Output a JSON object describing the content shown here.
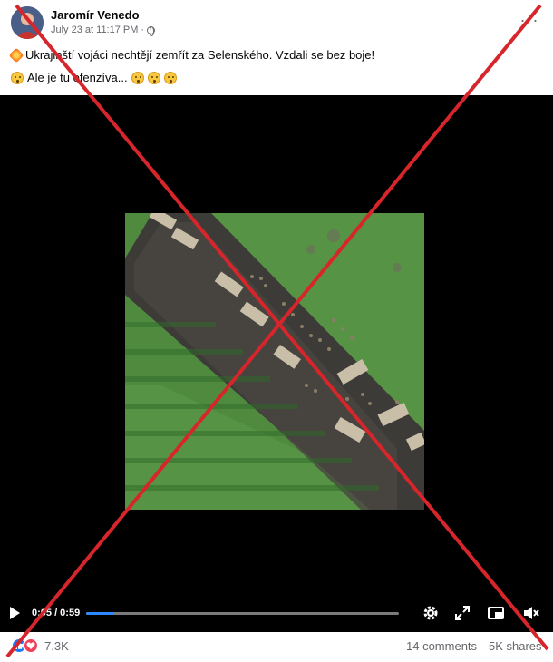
{
  "post": {
    "author": "Jaromír Venedo",
    "timestamp": "July 23 at 11:17 PM",
    "privacy_icon": "globe-icon",
    "more_icon": "more-options-icon",
    "text_line1": "Ukrajinští vojáci nechtějí zemřít za Selenského.  Vzdali se bez boje!",
    "text_line2": "Ale je tu ofenzíva...",
    "line1_emoji": "collision-emoji",
    "line2_emojis": [
      "thinking-face-emoji",
      "flushed-face-emoji",
      "flushed-face-emoji",
      "flushed-face-emoji"
    ]
  },
  "video": {
    "time_display": "0:05 / 0:59",
    "progress": 0.09,
    "controls": [
      "play-icon",
      "settings-icon",
      "expand-icon",
      "picture-in-picture-icon",
      "volume-muted-icon"
    ]
  },
  "footer": {
    "reaction_count": "7.3K",
    "reactions": [
      "like-reaction-icon",
      "love-reaction-icon"
    ],
    "comments": "14 comments",
    "shares": "5K shares"
  },
  "colors": {
    "overlay_x": "#d7262b",
    "progress": "#2d88ff",
    "like": "#1877f2",
    "love": "#f33e58"
  }
}
